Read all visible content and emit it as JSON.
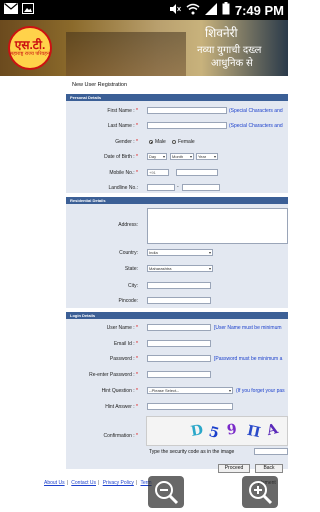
{
  "status_bar": {
    "time": "7:49 PM"
  },
  "header": {
    "logo_text": "एस.टी.",
    "logo_subtext": "महाराष्ट्र राज्य परिवहन",
    "title_line1": "शिवनेरी",
    "title_line2": "नव्या युगाची दख्ल",
    "title_line3": "आधुनिक से"
  },
  "form": {
    "title": "New User Registration",
    "personal_section": "Personal Details",
    "first_name_label": "First Name :",
    "first_name_note": "(Special Characters and",
    "last_name_label": "Last Name :",
    "last_name_note": "(Special Characters and",
    "gender_label": "Gender :",
    "gender_male": "Male",
    "gender_female": "Female",
    "dob_label": "Date of Birth :",
    "dob_day": "Day",
    "dob_month": "Month",
    "dob_year": "Year",
    "mobile_label": "Mobile No.:",
    "mobile_prefix": "+91",
    "landline_label": "Landline No.:",
    "residential_section": "Residential Details",
    "address_label": "Address:",
    "country_label": "Country:",
    "country_value": "India",
    "state_label": "State:",
    "state_value": "Maharashtra",
    "city_label": "City:",
    "pincode_label": "Pincode:",
    "login_section": "Login Details",
    "username_label": "User Name :",
    "username_note": "[User Name must be minimum",
    "email_label": "Email Id :",
    "password_label": "Password :",
    "password_note": "[Password must be minimum a",
    "reenter_label": "Re-enter Password :",
    "hint_q_label": "Hint Question :",
    "hint_q_value": "--Please Select--",
    "hint_q_note": "(If you forget your pas",
    "hint_a_label": "Hint Answer :",
    "confirmation_label": "Confirmation :",
    "captcha_prompt": "Type the security code as in the image",
    "proceed_label": "Proceed",
    "back_label": "Back"
  },
  "footer": {
    "about_us": "About Us",
    "contact_us": "Contact Us",
    "privacy_policy": "Privacy Policy",
    "terms": "Term",
    "trailing": "plement"
  }
}
